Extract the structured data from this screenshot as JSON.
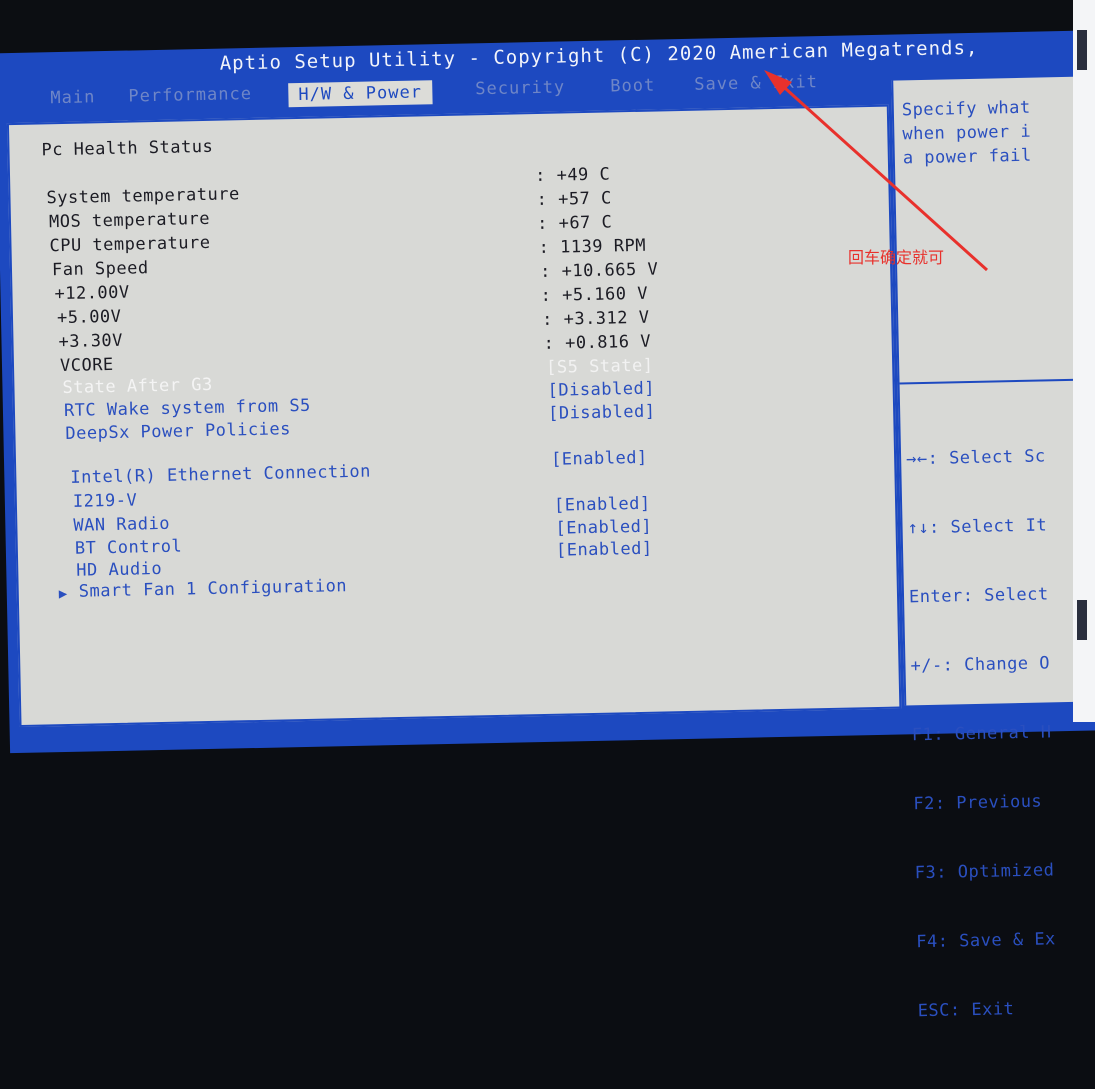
{
  "header": {
    "title": "Aptio Setup Utility - Copyright (C) 2020 American Megatrends,"
  },
  "tabs": [
    {
      "label": "Main",
      "state": "dim"
    },
    {
      "label": "Performance",
      "state": "dim"
    },
    {
      "label": "H/W & Power",
      "state": "active"
    },
    {
      "label": "Security",
      "state": "dim"
    },
    {
      "label": "Boot",
      "state": "dim"
    },
    {
      "label": "Save & Exit",
      "state": "dim"
    }
  ],
  "section_title": "Pc Health Status",
  "health": {
    "system_temperature": {
      "label": "System temperature",
      "value": ": +49 C"
    },
    "mos_temperature": {
      "label": "MOS temperature",
      "value": ": +57 C"
    },
    "cpu_temperature": {
      "label": "CPU temperature",
      "value": ": +67 C"
    },
    "fan_speed": {
      "label": "Fan Speed",
      "value": ": 1139 RPM"
    },
    "v12": {
      "label": "+12.00V",
      "value": ": +10.665 V"
    },
    "v5": {
      "label": "+5.00V",
      "value": ": +5.160 V"
    },
    "v33": {
      "label": "+3.30V",
      "value": ": +3.312 V"
    },
    "vcore": {
      "label": "VCORE",
      "value": ": +0.816 V"
    }
  },
  "settings": {
    "state_after_g3": {
      "label": "State After G3",
      "value": "[S5 State]"
    },
    "rtc_wake": {
      "label": "RTC Wake system from S5",
      "value": "[Disabled]"
    },
    "deepsx": {
      "label": "DeepSx Power Policies",
      "value": "[Disabled]"
    },
    "ethernet": {
      "label": "Intel(R) Ethernet Connection",
      "value": "[Enabled]"
    },
    "i219": {
      "label": "I219-V"
    },
    "wan_radio": {
      "label": "WAN Radio",
      "value": "[Enabled]"
    },
    "bt_control": {
      "label": "BT Control",
      "value": "[Enabled]"
    },
    "hd_audio": {
      "label": "HD Audio",
      "value": "[Enabled]"
    },
    "smart_fan": {
      "label": "Smart Fan 1 Configuration"
    }
  },
  "help_panel": {
    "line1": "Specify what",
    "line2": "when power i",
    "line3": "a power fail"
  },
  "key_help": [
    "→←: Select Sc",
    "↑↓: Select It",
    "Enter: Select",
    "+/-: Change O",
    "F1: General H",
    "F2: Previous",
    "F3: Optimized",
    "F4: Save & Ex",
    "ESC: Exit"
  ],
  "annotation": {
    "text": "回车确定就可",
    "color": "#e8312c"
  },
  "colors": {
    "bios_blue": "#1d49c0",
    "bios_grey": "#d8d9d6",
    "item_blue": "#2a4fbf"
  }
}
